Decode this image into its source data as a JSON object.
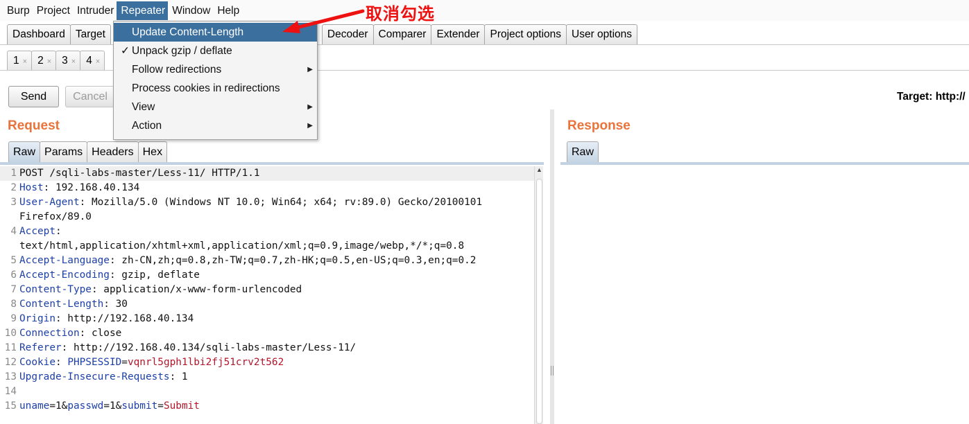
{
  "menubar": [
    "Burp",
    "Project",
    "Intruder",
    "Repeater",
    "Window",
    "Help"
  ],
  "main_tabs": [
    "Dashboard",
    "Target",
    "Decoder",
    "Comparer",
    "Extender",
    "Project options",
    "User options"
  ],
  "repeater_tabs": [
    "1",
    "2",
    "3",
    "4"
  ],
  "close_glyph": "×",
  "buttons": {
    "send": "Send",
    "cancel": "Cancel"
  },
  "target": "Target: http://",
  "request": {
    "heading": "Request",
    "tabs": [
      "Raw",
      "Params",
      "Headers",
      "Hex"
    ]
  },
  "response": {
    "heading": "Response",
    "tabs": [
      "Raw"
    ]
  },
  "dropdown": {
    "items": [
      {
        "label": "Update Content-Length",
        "checked": false,
        "submenu": false
      },
      {
        "label": "Unpack gzip / deflate",
        "checked": true,
        "submenu": false
      },
      {
        "label": "Follow redirections",
        "checked": false,
        "submenu": true
      },
      {
        "label": "Process cookies in redirections",
        "checked": false,
        "submenu": false
      },
      {
        "label": "View",
        "checked": false,
        "submenu": true
      },
      {
        "label": "Action",
        "checked": false,
        "submenu": true
      }
    ],
    "check_glyph": "✓",
    "submenu_glyph": "▶"
  },
  "annotation": "取消勾选",
  "editor_lines": [
    {
      "n": "1",
      "parts": [
        {
          "t": "POST /sqli-labs-master/Less-11/ HTTP/1.1",
          "c": "val"
        }
      ]
    },
    {
      "n": "2",
      "parts": [
        {
          "t": "Host",
          "c": "key"
        },
        {
          "t": ": 192.168.40.134",
          "c": "val"
        }
      ]
    },
    {
      "n": "3",
      "parts": [
        {
          "t": "User-Agent",
          "c": "key"
        },
        {
          "t": ": Mozilla/5.0 (Windows NT 10.0; Win64; x64; rv:89.0) Gecko/20100101",
          "c": "val"
        }
      ]
    },
    {
      "n": "",
      "parts": [
        {
          "t": "Firefox/89.0",
          "c": "val"
        }
      ]
    },
    {
      "n": "4",
      "parts": [
        {
          "t": "Accept",
          "c": "key"
        },
        {
          "t": ":",
          "c": "val"
        }
      ]
    },
    {
      "n": "",
      "parts": [
        {
          "t": "text/html,application/xhtml+xml,application/xml;q=0.9,image/webp,*/*;q=0.8",
          "c": "val"
        }
      ]
    },
    {
      "n": "5",
      "parts": [
        {
          "t": "Accept-Language",
          "c": "key"
        },
        {
          "t": ": zh-CN,zh;q=0.8,zh-TW;q=0.7,zh-HK;q=0.5,en-US;q=0.3,en;q=0.2",
          "c": "val"
        }
      ]
    },
    {
      "n": "6",
      "parts": [
        {
          "t": "Accept-Encoding",
          "c": "key"
        },
        {
          "t": ": gzip, deflate",
          "c": "val"
        }
      ]
    },
    {
      "n": "7",
      "parts": [
        {
          "t": "Content-Type",
          "c": "key"
        },
        {
          "t": ": application/x-www-form-urlencoded",
          "c": "val"
        }
      ]
    },
    {
      "n": "8",
      "parts": [
        {
          "t": "Content-Length",
          "c": "key"
        },
        {
          "t": ": 30",
          "c": "val"
        }
      ]
    },
    {
      "n": "9",
      "parts": [
        {
          "t": "Origin",
          "c": "key"
        },
        {
          "t": ": http://192.168.40.134",
          "c": "val"
        }
      ]
    },
    {
      "n": "10",
      "parts": [
        {
          "t": "Connection",
          "c": "key"
        },
        {
          "t": ": close",
          "c": "val"
        }
      ]
    },
    {
      "n": "11",
      "parts": [
        {
          "t": "Referer",
          "c": "key"
        },
        {
          "t": ": http://192.168.40.134/sqli-labs-master/Less-11/",
          "c": "val"
        }
      ]
    },
    {
      "n": "12",
      "parts": [
        {
          "t": "Cookie",
          "c": "key"
        },
        {
          "t": ": ",
          "c": "val"
        },
        {
          "t": "PHPSESSID",
          "c": "key"
        },
        {
          "t": "=",
          "c": "val"
        },
        {
          "t": "vqnrl5gph1lbi2fj51crv2t562",
          "c": "red"
        }
      ]
    },
    {
      "n": "13",
      "parts": [
        {
          "t": "Upgrade-Insecure-Requests",
          "c": "key"
        },
        {
          "t": ": 1",
          "c": "val"
        }
      ]
    },
    {
      "n": "14",
      "parts": []
    },
    {
      "n": "15",
      "parts": [
        {
          "t": "uname",
          "c": "key"
        },
        {
          "t": "=1&",
          "c": "val"
        },
        {
          "t": "passwd",
          "c": "key"
        },
        {
          "t": "=1&",
          "c": "val"
        },
        {
          "t": "submit",
          "c": "key"
        },
        {
          "t": "=",
          "c": "val"
        },
        {
          "t": "Submit",
          "c": "red"
        }
      ]
    }
  ]
}
